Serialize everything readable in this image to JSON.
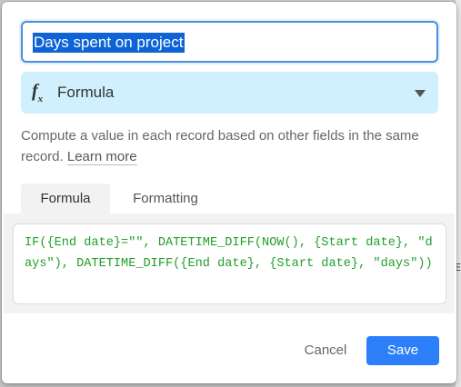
{
  "backdrop": {
    "edge_glyph": "E"
  },
  "dialog": {
    "field_name": {
      "value": "Days spent on project"
    },
    "field_type": {
      "icon": "formula-fx-icon",
      "label": "Formula"
    },
    "description": {
      "text": "Compute a value in each record based on other fields in the same record.",
      "link": "Learn more"
    },
    "tabs": [
      {
        "label": "Formula",
        "active": true
      },
      {
        "label": "Formatting",
        "active": false
      }
    ],
    "formula": {
      "text": "IF({End date}=\"\", DATETIME_DIFF(NOW(), {Start date}, \"days\"), DATETIME_DIFF({End date}, {Start date}, \"days\"))"
    },
    "actions": {
      "cancel": "Cancel",
      "save": "Save"
    }
  },
  "colors": {
    "accent": "#2d7ff9",
    "type_select_bg": "#d0f0fd",
    "formula_text": "#20a02a",
    "selection": "#0e64d6"
  }
}
